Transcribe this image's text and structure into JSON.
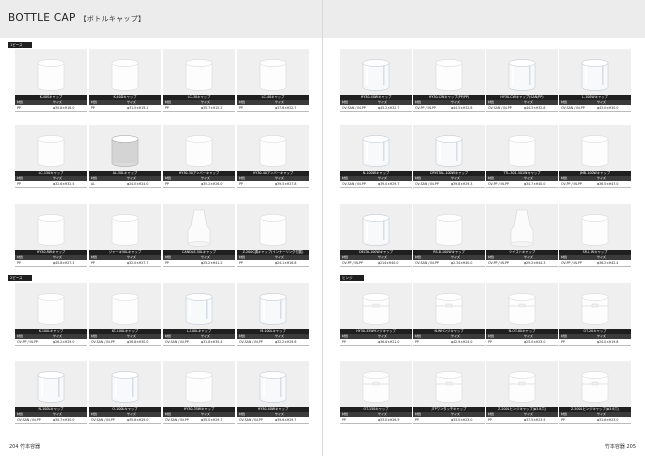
{
  "header": {
    "title": "BOTTLE CAP",
    "subtitle": "【ボトルキャップ】"
  },
  "sections": {
    "s1": "1ピース",
    "s2": "2ピース",
    "s3": "ヒンジ"
  },
  "labels": {
    "material": "材質",
    "size": "サイズ"
  },
  "cards": [
    {
      "name": "K-40Sキャップ",
      "mat": "PP",
      "size": "φ30.8×H16.0",
      "kind": "white",
      "hinge": false
    },
    {
      "name": "K-40Dキャップ",
      "mat": "PP",
      "size": "φ31.5×H19.1",
      "kind": "white",
      "hinge": false
    },
    {
      "name": "LC-30キャップ",
      "mat": "PP",
      "size": "φ35.7×H15.2",
      "kind": "white",
      "hinge": false
    },
    {
      "name": "LC-40キャップ",
      "mat": "PP",
      "size": "φ37.6×H22.7",
      "kind": "white",
      "hinge": false
    },
    {
      "name": "LC-150キャップ",
      "mat": "PP",
      "size": "φ32.6×H32.5",
      "kind": "white",
      "hinge": false
    },
    {
      "name": "AL-50Lキャップ",
      "mat": "AL",
      "size": "φ24.0×H24.0",
      "kind": "silver",
      "hinge": false
    },
    {
      "name": "HY30-30アンバーキャップ",
      "mat": "PP",
      "size": "φ35.2×H26.0",
      "kind": "white",
      "hinge": false
    },
    {
      "name": "HY30-40アンバーキャップ",
      "mat": "PP",
      "size": "φ39.5×H27.8",
      "kind": "white",
      "hinge": false
    },
    {
      "name": "HY30-RWキャップ",
      "mat": "PP",
      "size": "φ45.8×H27.3",
      "kind": "white",
      "hinge": false
    },
    {
      "name": "ジャーキ50Lキャップ",
      "mat": "PP",
      "size": "φ32.0×H27.7",
      "kind": "white",
      "hinge": false
    },
    {
      "name": "CANDLE-50Lキャップ",
      "mat": "PP",
      "size": "φ25.2×H41.2",
      "kind": "nozzle",
      "hinge": false
    },
    {
      "name": "Z-200C調キャップ(インナーリング付属)",
      "mat": "PP",
      "size": "φ24.1×H16.8",
      "kind": "white",
      "hinge": false
    },
    {
      "name": "K-100Lキャップ",
      "mat": "OV-PP / IN-PP",
      "size": "φ26.2×H29.0",
      "kind": "white",
      "hinge": false
    },
    {
      "name": "KT-100Lキャップ",
      "mat": "OV-SAN / IN-PP",
      "size": "φ36.8×H30.0",
      "kind": "white",
      "hinge": false
    },
    {
      "name": "L-100Lキャップ",
      "mat": "OV-SAN / IN-PP",
      "size": "φ31.8×H30.4",
      "kind": "clear",
      "hinge": false
    },
    {
      "name": "M-100Lキャップ",
      "mat": "OV-SAN / IN-PP",
      "size": "φ32.2×H29.6",
      "kind": "clear",
      "hinge": false
    },
    {
      "name": "N-100Lキャップ",
      "mat": "OV-SAN / IN-PP",
      "size": "φ30.7×H30.0",
      "kind": "clear",
      "hinge": false
    },
    {
      "name": "O-100Lキャップ",
      "mat": "OV-SAN / IN-PP",
      "size": "φ35.8×H29.0",
      "kind": "clear",
      "hinge": false
    },
    {
      "name": "HY30-35Wキャップ",
      "mat": "OV-SAN / IN-PP",
      "size": "φ35.0×H29.7",
      "kind": "white",
      "hinge": false
    },
    {
      "name": "HY30-40Wキャップ",
      "mat": "OV-SAN / IN-PP",
      "size": "φ39.6×H29.7",
      "kind": "clear",
      "hinge": false
    },
    {
      "name": "HY30-40Wキャップ",
      "mat": "OV-SAN / IN-PP",
      "size": "φ45.2×H32.7",
      "kind": "clear",
      "hinge": false
    },
    {
      "name": "HY30-CWキャップ(PP/PP)",
      "mat": "OV-PP / IN-PP",
      "size": "φ44.5×H32.8",
      "kind": "white",
      "hinge": false
    },
    {
      "name": "HY30-CWキャップ(SAN/PP)",
      "mat": "OV-SAN / IN-PP",
      "size": "φ44.3×H32.8",
      "kind": "clear",
      "hinge": false
    },
    {
      "name": "L-100Wキャップ",
      "mat": "OV-SAN / IN-PP",
      "size": "φ43.0×H30.0",
      "kind": "clear",
      "hinge": false
    },
    {
      "name": "N-100Wキャップ",
      "mat": "OV-SAN / IN-PP",
      "size": "φ39.0×H29.7",
      "kind": "clear",
      "hinge": false
    },
    {
      "name": "CRYSTAL-100Wキャップ",
      "mat": "OV-SAN / IN-PP",
      "size": "φ39.8×H29.3",
      "kind": "clear",
      "hinge": false
    },
    {
      "name": "TTL-301-501Wキャップ",
      "mat": "OV-PP / IN-PP",
      "size": "φ34.7×H40.0",
      "kind": "white",
      "hinge": false
    },
    {
      "name": "JMB-100Wキャップ",
      "mat": "OV-PP / IN-PP",
      "size": "φ36.5×H47.0",
      "kind": "white",
      "hinge": false
    },
    {
      "name": "DELTA-100Wキャップ",
      "mat": "OV-PP / IN-PP",
      "size": "φ214×H40.0",
      "kind": "clear",
      "hinge": false
    },
    {
      "name": "RS-8-100Wキャップ",
      "mat": "OV-SAN / IN-PP",
      "size": "φ2.34×H40.0",
      "kind": "white",
      "hinge": false
    },
    {
      "name": "ツイストキャップ",
      "mat": "OV-PP / IN-PP",
      "size": "φ29.2×H44.3",
      "kind": "nozzle",
      "hinge": false
    },
    {
      "name": "SR-L Wキャップ",
      "mat": "OV-PP / IN-PP",
      "size": "φ36.2×H42.4",
      "kind": "white",
      "hinge": false
    },
    {
      "name": "HY30-35WHンジキャップ",
      "mat": "PP",
      "size": "φ36.8×H21.0",
      "kind": "white",
      "hinge": true
    },
    {
      "name": "N-WHンジキャップ",
      "mat": "PP",
      "size": "φ42.9×H24.0",
      "kind": "white",
      "hinge": true
    },
    {
      "name": "N-OT-80キャップ",
      "mat": "PP",
      "size": "φ25.0×H23.0",
      "kind": "white",
      "hinge": true
    },
    {
      "name": "OT-20キャップ",
      "mat": "PP",
      "size": "φ24.0×H19.8",
      "kind": "white",
      "hinge": true
    },
    {
      "name": "OT-150キャップ",
      "mat": "PP",
      "size": "φ33.0×H26.5",
      "kind": "white",
      "hinge": true
    },
    {
      "name": "JTPワンタッチキャップ",
      "mat": "PP",
      "size": "φ33.0×H23.0",
      "kind": "white",
      "hinge": true
    },
    {
      "name": "Z-200Lヒンジキャップ(ϕ3.8穴)",
      "mat": "PP",
      "size": "φ37.5×H23.5",
      "kind": "white",
      "hinge": true
    },
    {
      "name": "Z-500Lヒンジキャップ(ϕ3.8穴)",
      "mat": "PP",
      "size": "φ31.6×H23.0",
      "kind": "white",
      "hinge": true
    }
  ],
  "footer": {
    "left_page": "204",
    "left_brand": "竹本容器",
    "right_brand": "竹本容器",
    "right_page": "205"
  }
}
